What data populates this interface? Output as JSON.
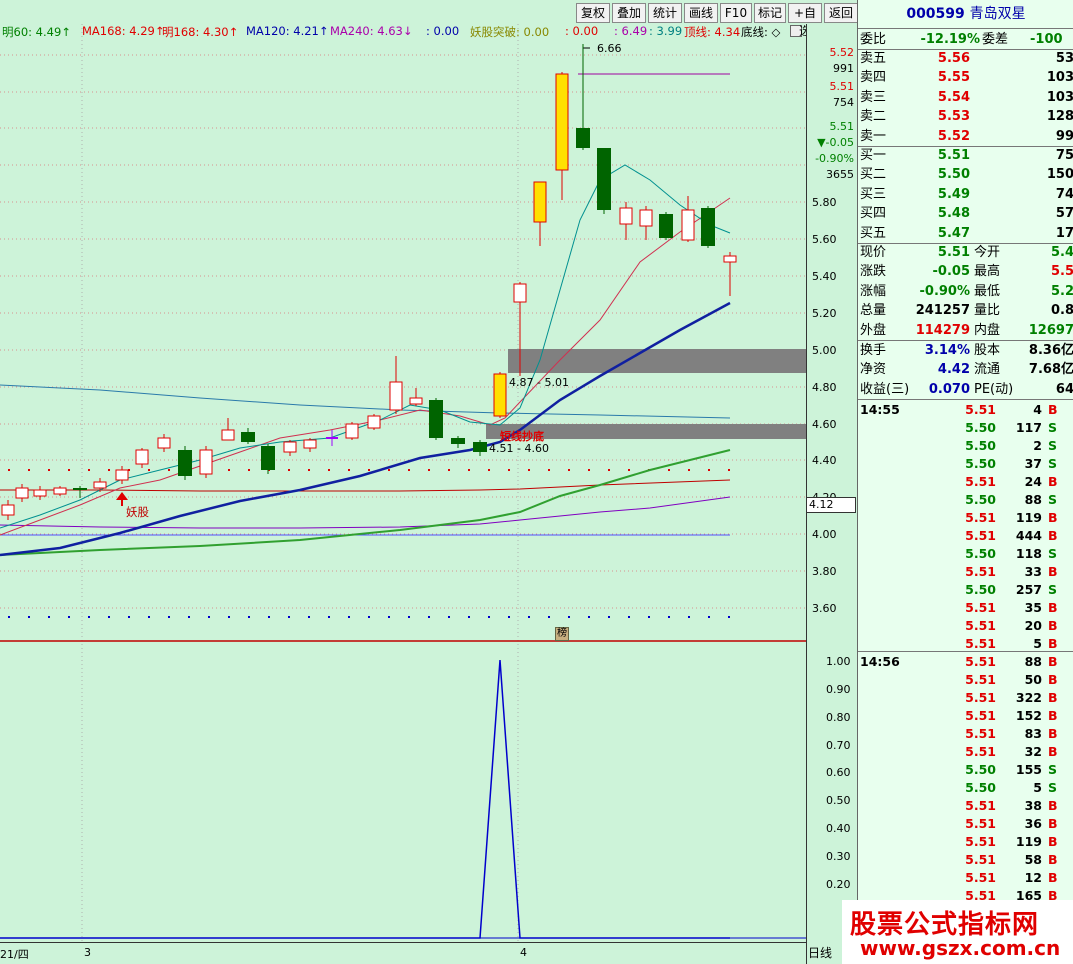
{
  "indicators": [
    {
      "label": "明60: 4.49",
      "color": "#008000",
      "arrow": "↑"
    },
    {
      "label": "MA168: 4.29",
      "color": "#e00000",
      "arrow": "↑"
    },
    {
      "label": "明168: 4.30",
      "color": "#e00000",
      "arrow": "↑"
    },
    {
      "label": "MA120: 4.21",
      "color": "#0000aa",
      "arrow": "↑"
    },
    {
      "label": "MA240: 4.63",
      "color": "#aa00aa",
      "arrow": "↓"
    },
    {
      "label": ": 0.00",
      "color": "#0000aa",
      "arrow": ""
    },
    {
      "label": "妖股突破: 0.00",
      "color": "#888800",
      "arrow": ""
    },
    {
      "label": ": 0.00",
      "color": "#e00000",
      "arrow": ""
    },
    {
      "label": ": 6.49",
      "color": "#aa00aa",
      "arrow": ""
    },
    {
      "label": ": 3.99",
      "color": "#008080",
      "arrow": ""
    },
    {
      "label": "顶线: 4.34",
      "color": "#e00000",
      "arrow": ""
    },
    {
      "label": "底线: ◇",
      "color": "#000000",
      "arrow": ""
    }
  ],
  "toolbar": [
    "复权",
    "叠加",
    "统计",
    "画线",
    "F10",
    "标记",
    "+自选",
    "返回"
  ],
  "stock": {
    "code": "000599",
    "name": "青岛双星"
  },
  "axis_main": [
    "5.80",
    "5.60",
    "5.40",
    "5.20",
    "5.00",
    "4.80",
    "4.60",
    "4.40",
    "4.20",
    "4.00",
    "3.80",
    "3.60"
  ],
  "axis_info": [
    {
      "t": "5.52",
      "c": "red"
    },
    {
      "t": "991",
      "c": "black"
    },
    {
      "t": "5.51",
      "c": "red"
    },
    {
      "t": "754",
      "c": "black"
    },
    {
      "t": "5.51",
      "c": "green"
    },
    {
      "t": "▼-0.05",
      "c": "green"
    },
    {
      "t": "-0.90%",
      "c": "green"
    },
    {
      "t": "3655",
      "c": "black"
    }
  ],
  "price_tag": "4.12",
  "axis_sub": [
    "1.00",
    "0.90",
    "0.80",
    "0.70",
    "0.60",
    "0.50",
    "0.40",
    "0.30",
    "0.20"
  ],
  "chart_labels": {
    "high": "6.66",
    "range1": "4.87 - 5.01",
    "range2": "4.51 - 4.60",
    "yao": "妖股",
    "zone_text": "短线抄底",
    "bang": "榜"
  },
  "xaxis": {
    "left": "21/四",
    "m1": "3",
    "m2": "4",
    "period": "日线"
  },
  "weibi": {
    "label": "委比",
    "value": "-12.19%",
    "label2": "委差",
    "value2": "-100"
  },
  "asks": [
    {
      "label": "卖五",
      "price": "5.56",
      "vol": "53"
    },
    {
      "label": "卖四",
      "price": "5.55",
      "vol": "103"
    },
    {
      "label": "卖三",
      "price": "5.54",
      "vol": "103"
    },
    {
      "label": "卖二",
      "price": "5.53",
      "vol": "128"
    },
    {
      "label": "卖一",
      "price": "5.52",
      "vol": "99"
    }
  ],
  "bids": [
    {
      "label": "买一",
      "price": "5.51",
      "vol": "75"
    },
    {
      "label": "买二",
      "price": "5.50",
      "vol": "150"
    },
    {
      "label": "买三",
      "price": "5.49",
      "vol": "74"
    },
    {
      "label": "买四",
      "price": "5.48",
      "vol": "57"
    },
    {
      "label": "买五",
      "price": "5.47",
      "vol": "17"
    }
  ],
  "quote": [
    {
      "l1": "现价",
      "v1": "5.51",
      "c1": "green",
      "l2": "今开",
      "v2": "5.4",
      "c2": "green"
    },
    {
      "l1": "涨跌",
      "v1": "-0.05",
      "c1": "green",
      "l2": "最高",
      "v2": "5.5",
      "c2": "red"
    },
    {
      "l1": "涨幅",
      "v1": "-0.90%",
      "c1": "green",
      "l2": "最低",
      "v2": "5.2",
      "c2": "green"
    },
    {
      "l1": "总量",
      "v1": "241257",
      "c1": "black",
      "l2": "量比",
      "v2": "0.8",
      "c2": "black"
    },
    {
      "l1": "外盘",
      "v1": "114279",
      "c1": "red",
      "l2": "内盘",
      "v2": "12697",
      "c2": "green"
    }
  ],
  "fund": [
    {
      "l1": "换手",
      "v1": "3.14%",
      "l2": "股本",
      "v2": "8.36亿"
    },
    {
      "l1": "净资",
      "v1": "4.42",
      "l2": "流通",
      "v2": "7.68亿"
    },
    {
      "l1": "收益(三)",
      "v1": "0.070",
      "l2": "PE(动)",
      "v2": "64"
    }
  ],
  "ticks1": {
    "time": "14:55",
    "rows": [
      {
        "p": "5.51",
        "v": "4",
        "d": "B"
      },
      {
        "p": "5.50",
        "v": "117",
        "d": "S"
      },
      {
        "p": "5.50",
        "v": "2",
        "d": "S"
      },
      {
        "p": "5.50",
        "v": "37",
        "d": "S"
      },
      {
        "p": "5.51",
        "v": "24",
        "d": "B"
      },
      {
        "p": "5.50",
        "v": "88",
        "d": "S"
      },
      {
        "p": "5.51",
        "v": "119",
        "d": "B"
      },
      {
        "p": "5.51",
        "v": "444",
        "d": "B"
      },
      {
        "p": "5.50",
        "v": "118",
        "d": "S"
      },
      {
        "p": "5.51",
        "v": "33",
        "d": "B"
      },
      {
        "p": "5.50",
        "v": "257",
        "d": "S"
      },
      {
        "p": "5.51",
        "v": "35",
        "d": "B"
      },
      {
        "p": "5.51",
        "v": "20",
        "d": "B"
      },
      {
        "p": "5.51",
        "v": "5",
        "d": "B"
      }
    ]
  },
  "ticks2": {
    "time": "14:56",
    "rows": [
      {
        "p": "5.51",
        "v": "88",
        "d": "B"
      },
      {
        "p": "5.51",
        "v": "50",
        "d": "B"
      },
      {
        "p": "5.51",
        "v": "322",
        "d": "B"
      },
      {
        "p": "5.51",
        "v": "152",
        "d": "B"
      },
      {
        "p": "5.51",
        "v": "83",
        "d": "B"
      },
      {
        "p": "5.51",
        "v": "32",
        "d": "B"
      },
      {
        "p": "5.50",
        "v": "155",
        "d": "S"
      },
      {
        "p": "5.50",
        "v": "5",
        "d": "S"
      },
      {
        "p": "5.51",
        "v": "38",
        "d": "B"
      },
      {
        "p": "5.51",
        "v": "36",
        "d": "B"
      },
      {
        "p": "5.51",
        "v": "119",
        "d": "B"
      },
      {
        "p": "5.51",
        "v": "58",
        "d": "B"
      },
      {
        "p": "5.51",
        "v": "12",
        "d": "B"
      },
      {
        "p": "5.51",
        "v": "165",
        "d": "B"
      }
    ]
  },
  "watermark": {
    "title": "股票公式指标网",
    "url": "www.gszx.com.cn"
  }
}
